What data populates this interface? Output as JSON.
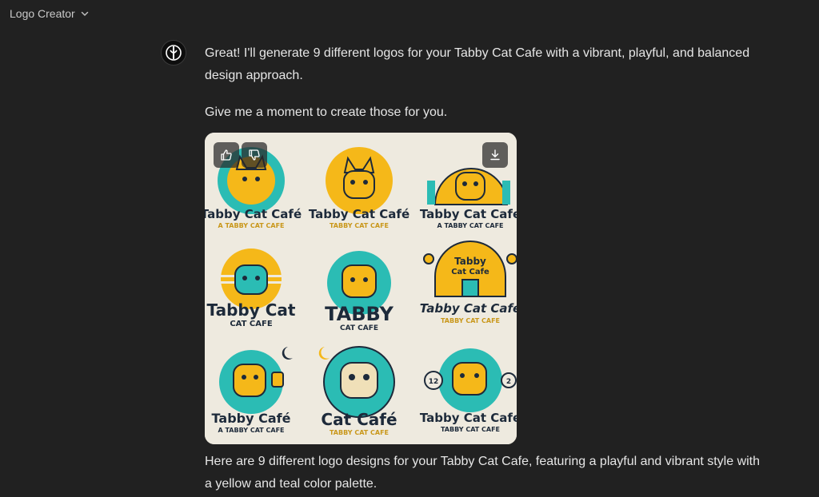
{
  "header": {
    "app_title": "Logo Creator",
    "dropdown_icon": "chevron-down-icon"
  },
  "assistant": {
    "avatar_icon": "logo-creator-avatar-icon"
  },
  "messages": {
    "intro": "Great! I'll generate 9 different logos for your Tabby Cat Cafe with a vibrant, playful, and balanced design approach.",
    "wait": "Give me a moment to create those for you.",
    "result": "Here are 9 different logo designs for your Tabby Cat Cafe, featuring a playful and vibrant style with a yellow and teal color palette."
  },
  "image_actions": {
    "like_icon": "thumbs-up-icon",
    "dislike_icon": "thumbs-down-icon",
    "download_icon": "download-icon"
  },
  "generated_logos": [
    {
      "title": "Tabby Cat Café",
      "subtitle": "A TABBY CAT CAFE"
    },
    {
      "title": "Tabby Cat Café",
      "subtitle": "TABBY CAT CAFE"
    },
    {
      "title": "Tabby Cat Cafe",
      "subtitle": "A TABBY CAT CAFE"
    },
    {
      "title": "Tabby Cat",
      "subtitle": "CAT CAFE"
    },
    {
      "title": "TABBY",
      "subtitle": "CAT CAFE"
    },
    {
      "title": "Tabby Cat Cafe",
      "subtitle": "TABBY CAT CAFE",
      "sign_top": "Tabby",
      "sign_bottom": "Cat Cafe"
    },
    {
      "title": "Tabby Café",
      "subtitle": "A TABBY CAT CAFE"
    },
    {
      "title": "Cat Café",
      "subtitle": "TABBY CAT CAFE"
    },
    {
      "title": "Tabby Cat Cafe",
      "subtitle": "TABBY CAT CAFE",
      "badge_left": "12",
      "badge_right": "2"
    }
  ],
  "colors": {
    "yellow": "#f5b819",
    "teal": "#2bbcb4",
    "navy": "#1d2a3a",
    "cream": "#eeeadf"
  }
}
